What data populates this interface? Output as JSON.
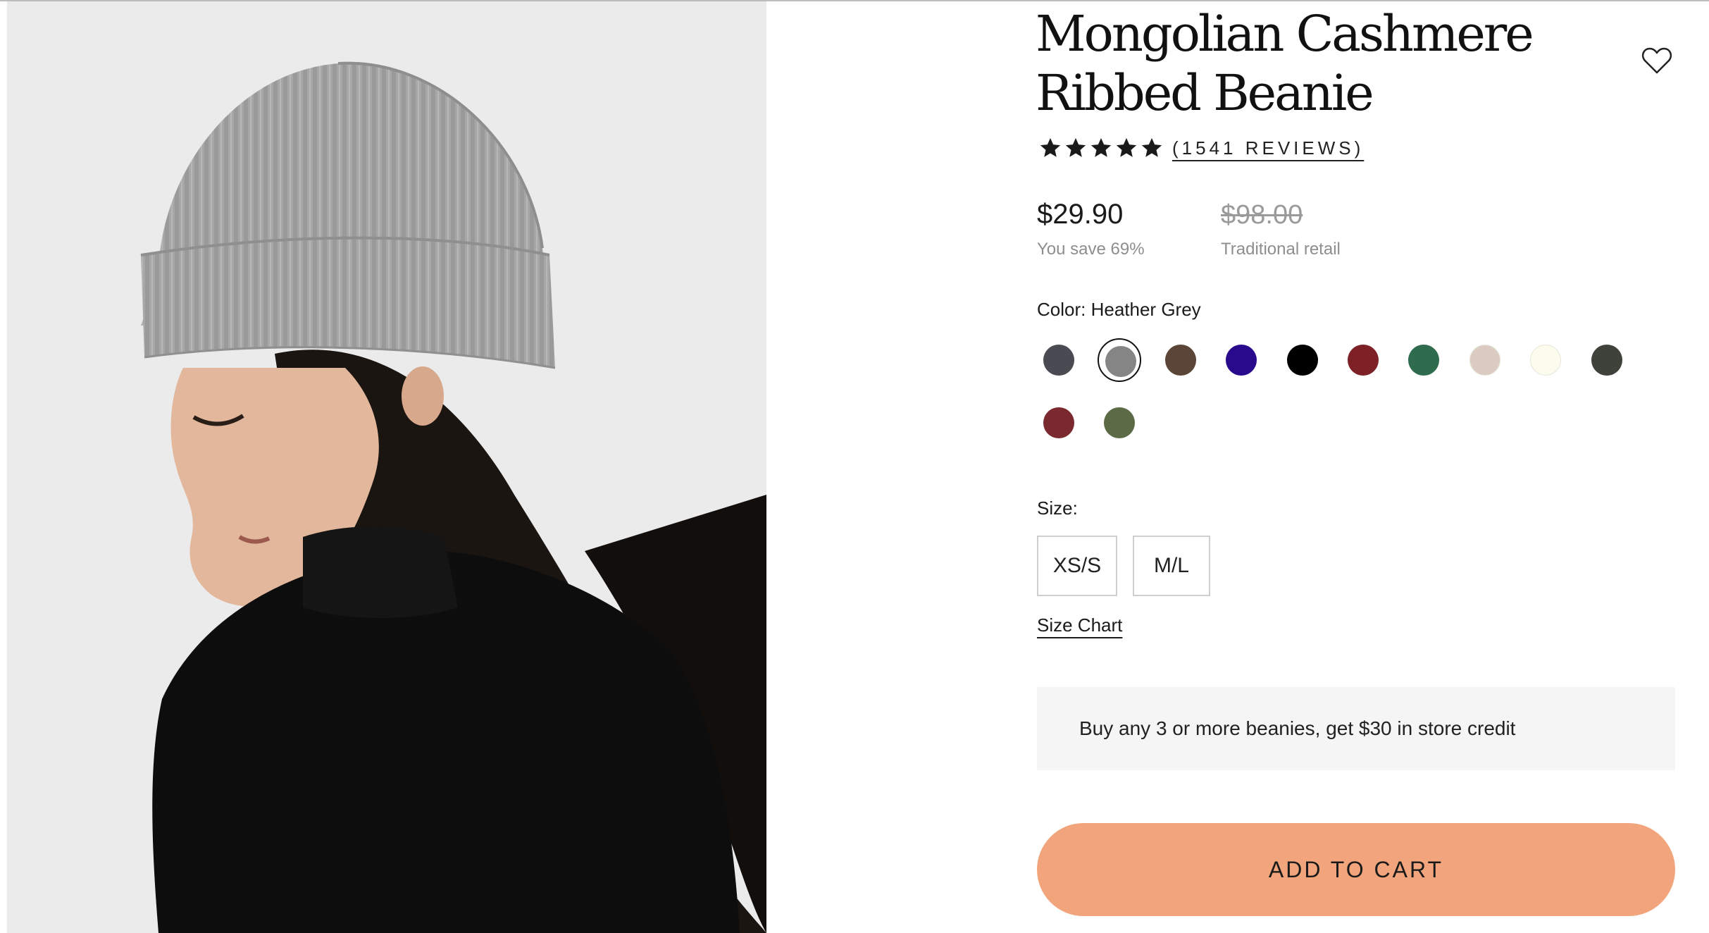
{
  "product": {
    "title": "Mongolian Cashmere Ribbed Beanie",
    "image_alt": "Woman wearing a grey ribbed cashmere beanie, viewed from behind"
  },
  "wishlist": {
    "icon": "heart-icon"
  },
  "rating": {
    "stars": 5,
    "star_icon": "star-icon",
    "reviews_text": "(1541 REVIEWS)"
  },
  "pricing": {
    "price": "$29.90",
    "savings": "You save 69%",
    "original_price": "$98.00",
    "original_label": "Traditional retail"
  },
  "color": {
    "label": "Color:",
    "selected": "Heather Grey",
    "swatches": [
      {
        "color": "#4a4b52"
      },
      {
        "color": "#858585",
        "selected": true
      },
      {
        "color": "#5b4537"
      },
      {
        "color": "#2a0a8c"
      },
      {
        "color": "#000000"
      },
      {
        "color": "#7e2126"
      },
      {
        "color": "#2f6b4d"
      },
      {
        "color": "#dccbc2"
      },
      {
        "color": "#fbfbee"
      },
      {
        "color": "#3f413b"
      },
      {
        "color": "#7a2a2e"
      },
      {
        "color": "#5a6b45"
      }
    ]
  },
  "size": {
    "label": "Size:",
    "options": [
      "XS/S",
      "M/L"
    ],
    "chart_link": "Size Chart"
  },
  "promo": {
    "text": "Buy any 3 or more beanies, get $30 in store credit"
  },
  "cart": {
    "label": "ADD TO CART",
    "color": "#f2a57c"
  }
}
